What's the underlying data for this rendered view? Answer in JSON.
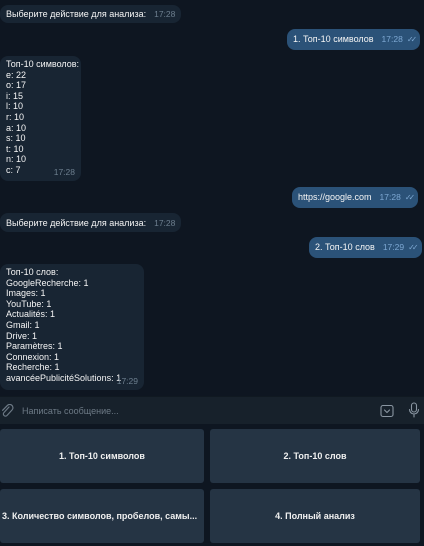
{
  "messages": [
    {
      "text": "Выберите действие для анализа:",
      "time": "17:28"
    },
    {
      "text": "1. Топ-10 символов",
      "time": "17:28"
    },
    {
      "text": "Топ-10 символов:\ne: 22\no: 17\ni: 15\nl: 10\nr: 10\na: 10\ns: 10\nt: 10\nn: 10\nc: 7",
      "time": "17:28"
    },
    {
      "text": "https://google.com",
      "time": "17:28"
    },
    {
      "text": "Выберите действие для анализа:",
      "time": "17:28"
    },
    {
      "text": "2. Топ-10 слов",
      "time": "17:29"
    },
    {
      "text": "Топ-10 слов:\nGoogleRecherche: 1\nImages: 1\nYouTube: 1\nActualités: 1\nGmail: 1\nDrive: 1\nParamètres: 1\nConnexion: 1\nRecherche: 1\navancéePublicitéSolutions: 1",
      "time": "17:29"
    }
  ],
  "composer": {
    "placeholder": "Написать сообщение..."
  },
  "keyboard": {
    "buttons": [
      "1. Топ-10 символов",
      "2. Топ-10 слов",
      "3. Количество символов, пробелов, самы...",
      "4. Полный анализ"
    ]
  },
  "colors": {
    "background": "#0e1621",
    "incoming_bubble": "#182533",
    "outgoing_bubble": "#2b5278",
    "keyboard_button": "#253444"
  }
}
